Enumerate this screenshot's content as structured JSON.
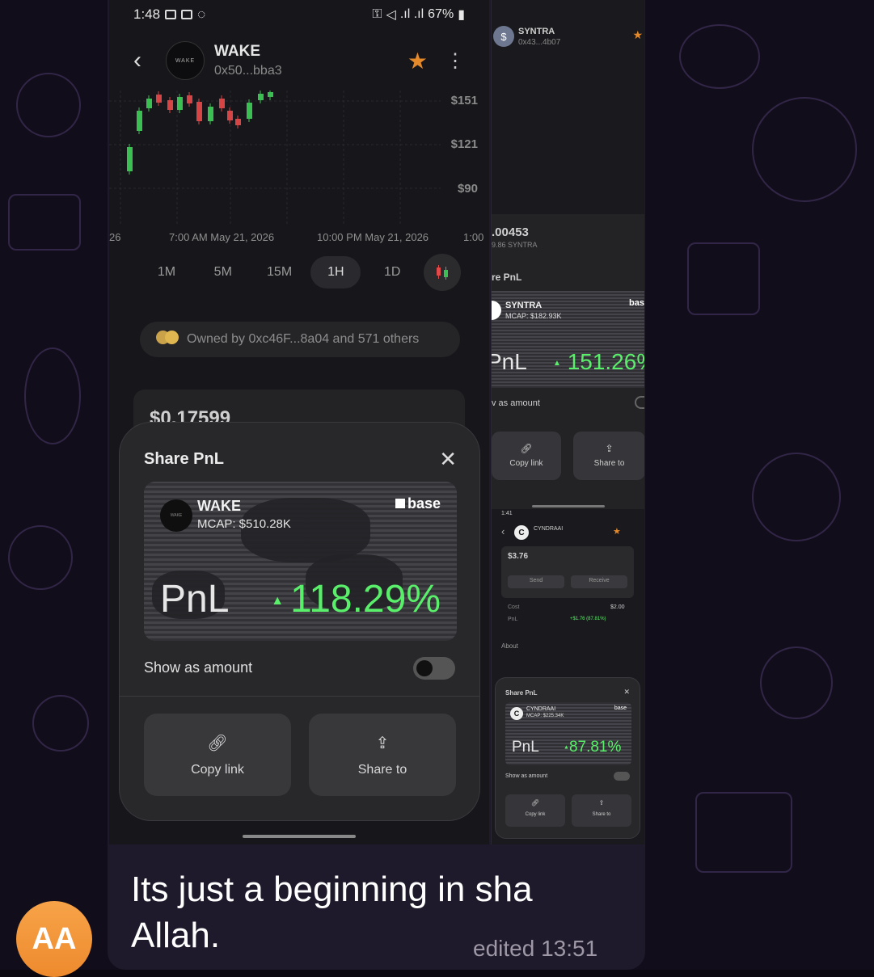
{
  "status": {
    "time": "1:48",
    "battery": "67%"
  },
  "token": {
    "name": "WAKE",
    "address": "0x50...bba3",
    "avatar_text": "WAKE"
  },
  "chart_prices": [
    "$151",
    "$121",
    "$90"
  ],
  "chart_times": [
    "26",
    "7:00 AM May 21, 2026",
    "10:00 PM May 21, 2026",
    "1:00"
  ],
  "timeframes": [
    "1M",
    "5M",
    "15M",
    "1H",
    "1D"
  ],
  "owned_by": "Owned by 0xc46F...8a04 and 571 others",
  "balance": "$0.17599",
  "share": {
    "title": "Share PnL",
    "ticker": "WAKE",
    "mcap": "MCAP: $510.28K",
    "chain": "base",
    "pnl_label": "PnL",
    "pnl_value": "118.29%",
    "show_as_amount": "Show as amount",
    "copy_link": "Copy link",
    "share_to": "Share to"
  },
  "right_phone": {
    "token_name": "SYNTRA",
    "token_address": "0x43...4b07",
    "price": ".00453",
    "holdings": "9.86 SYNTRA",
    "section": "re PnL",
    "card_ticker": "SYNTRA",
    "card_mcap": "MCAP: $182.93K",
    "card_chain": "bas",
    "pnl_label": "PnL",
    "pnl_value": "151.26%",
    "show_as_amount": "v as amount",
    "copy_link": "Copy link",
    "share_to": "Share to"
  },
  "mini_phone": {
    "time": "1:41",
    "token_name": "CYNDRAAI",
    "price": "$3.76",
    "send": "Send",
    "receive": "Receive",
    "cost_label": "Cost",
    "cost_value": "$2.00",
    "pnl_row_label": "PnL",
    "pnl_row_value": "+$1.76 (87.81%)",
    "about": "About",
    "share_title": "Share PnL",
    "card_ticker": "CYNDRAAI",
    "card_mcap": "MCAP: $225.34K",
    "card_chain": "base",
    "pnl_label": "PnL",
    "pnl_value": "87.81%",
    "show_as_amount": "Show as amount",
    "copy_link": "Copy link",
    "share_to": "Share to"
  },
  "message": {
    "text": "Its just a beginning in sha Allah.",
    "edited": "edited 13:51",
    "avatar_initials": "AA"
  },
  "colors": {
    "green": "#5aef6a",
    "orange": "#e58a2b",
    "red": "#d64545"
  }
}
